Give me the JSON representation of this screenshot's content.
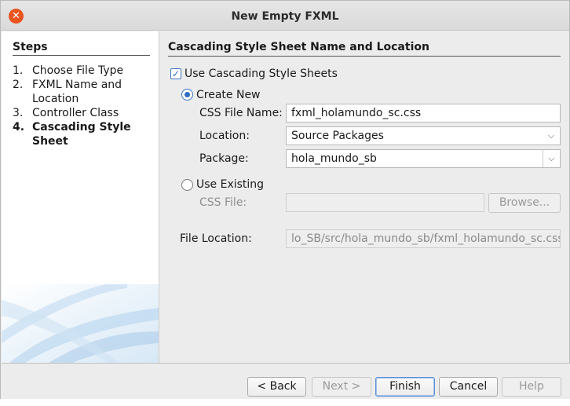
{
  "window": {
    "title": "New Empty FXML",
    "close_glyph": "✕"
  },
  "steps": {
    "heading": "Steps",
    "items": [
      {
        "num": "1.",
        "label": "Choose File Type",
        "current": false
      },
      {
        "num": "2.",
        "label": "FXML Name and Location",
        "current": false
      },
      {
        "num": "3.",
        "label": "Controller Class",
        "current": false
      },
      {
        "num": "4.",
        "label": "Cascading Style Sheet",
        "current": true
      }
    ]
  },
  "main": {
    "heading": "Cascading Style Sheet Name and Location",
    "use_css": {
      "label": "Use Cascading Style Sheets",
      "checked": true
    },
    "create_new": {
      "label": "Create New",
      "selected": true,
      "css_file_name_label": "CSS File Name:",
      "css_file_name_value": "fxml_holamundo_sc.css",
      "location_label": "Location:",
      "location_value": "Source Packages",
      "package_label": "Package:",
      "package_value": "hola_mundo_sb"
    },
    "use_existing": {
      "label": "Use Existing",
      "selected": false,
      "css_file_label": "CSS File:",
      "css_file_value": "",
      "browse_label": "Browse..."
    },
    "file_location_label": "File Location:",
    "file_location_value": "lo_SB/src/hola_mundo_sb/fxml_holamundo_sc.css"
  },
  "footer": {
    "back_label": "< Back",
    "next_label": "Next >",
    "finish_label": "Finish",
    "cancel_label": "Cancel",
    "help_label": "Help"
  },
  "colors": {
    "accent": "#2f6fc1",
    "close": "#e9541f",
    "panel": "#ececec"
  },
  "icons": {
    "close": "close-icon",
    "checkmark": "checkmark-icon",
    "dropdown": "chevron-down-icon"
  }
}
